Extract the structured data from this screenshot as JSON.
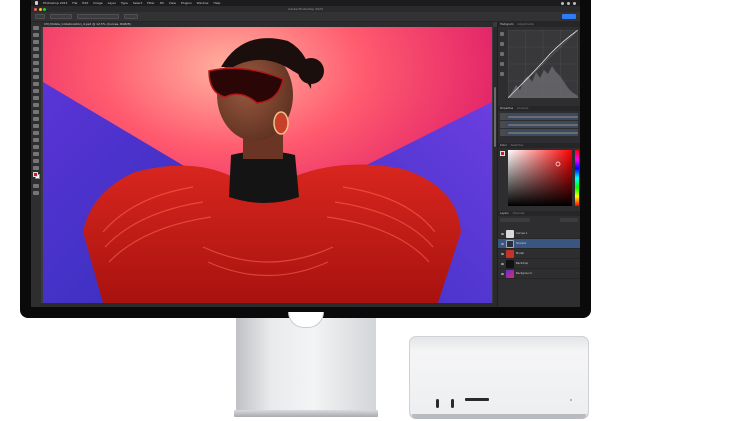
{
  "menubar": {
    "items": [
      "Photoshop 2023",
      "File",
      "Edit",
      "Image",
      "Layer",
      "Type",
      "Select",
      "Filter",
      "3D",
      "View",
      "Plugins",
      "Window",
      "Help"
    ]
  },
  "window": {
    "title": "Adobe Photoshop 2023"
  },
  "document": {
    "tab_label": "CM_Mobile_Collaboration_4.psd @ 12.5% (Curves, RGB/8)"
  },
  "panels": {
    "top_tabs": [
      "Histogram",
      "Adjustments"
    ],
    "top_tabs_selected": 0,
    "adjust_tabs": [
      "Properties",
      "Libraries"
    ],
    "color_tabs": [
      "Color",
      "Swatches"
    ],
    "layers_tabs": [
      "Layers",
      "Channels"
    ],
    "layers": [
      {
        "name": "Curves 1",
        "selected": false,
        "thumb_color": "#d9d9d9"
      },
      {
        "name": "Shadow",
        "selected": true,
        "thumb_color": "#2a2f3a"
      },
      {
        "name": "Model",
        "selected": false,
        "thumb_color": "#c4332a"
      },
      {
        "name": "Backdrop",
        "selected": false,
        "thumb_color": "#111111"
      },
      {
        "name": "Background",
        "selected": false,
        "thumb_color": "#d2245a"
      }
    ]
  },
  "colors": {
    "accent": "#2f7df6",
    "selection": "#3a5680",
    "foreground_swatch": "#c81d1d",
    "background_swatch": "#ffffff"
  },
  "icons": {
    "apple": "apple-logo-icon",
    "share": "share-icon"
  }
}
